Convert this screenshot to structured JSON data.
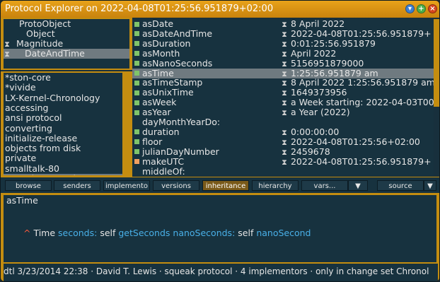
{
  "window": {
    "title": "Protocol Explorer on 2022-04-08T01:25:56.951879+02:00"
  },
  "class_tree": [
    {
      "label": "ProtoObject",
      "icon": ""
    },
    {
      "label": "Object",
      "icon": ""
    },
    {
      "label": "Magnitude",
      "icon": "hourglass-icon"
    },
    {
      "label": "DateAndTime",
      "icon": "hourglass-icon",
      "selected": true
    }
  ],
  "categories": [
    "*ston-core",
    "*vivide",
    "LX-Kernel-Chronology",
    "accessing",
    "ansi protocol",
    "converting",
    "initialize-release",
    "objects from disk",
    "private",
    "smalltalk-80",
    "squeak protocol"
  ],
  "selected_category": "squeak protocol",
  "messages": [
    {
      "name": "asDate",
      "value": "8 April 2022",
      "mark": "green"
    },
    {
      "name": "asDateAndTime",
      "value": "2022-04-08T01:25:56.951879+",
      "mark": "green"
    },
    {
      "name": "asDuration",
      "value": "0:01:25:56.951879",
      "mark": "green"
    },
    {
      "name": "asMonth",
      "value": "April 2022",
      "mark": "green"
    },
    {
      "name": "asNanoSeconds",
      "value": "5156951879000",
      "mark": "green"
    },
    {
      "name": "asTime",
      "value": "1:25:56.951879 am",
      "mark": "green",
      "selected": true
    },
    {
      "name": "asTimeStamp",
      "value": "8 April 2022 1:25:56.951879 am",
      "mark": "green"
    },
    {
      "name": "asUnixTime",
      "value": "1649373956",
      "mark": "green"
    },
    {
      "name": "asWeek",
      "value": "a Week starting: 2022-04-03T00",
      "mark": "green"
    },
    {
      "name": "asYear",
      "value": "a Year (2022)",
      "mark": "green"
    },
    {
      "name": "dayMonthYearDo:",
      "value": "",
      "mark": ""
    },
    {
      "name": "duration",
      "value": "0:00:00:00",
      "mark": "green"
    },
    {
      "name": "floor",
      "value": "2022-04-08T01:25:56+02:00",
      "mark": "green"
    },
    {
      "name": "julianDayNumber",
      "value": "2459678",
      "mark": "green"
    },
    {
      "name": "makeUTC",
      "value": "2022-04-08T01:25:56.951879+",
      "mark": "orange"
    },
    {
      "name": "middleOf:",
      "value": "",
      "mark": ""
    }
  ],
  "buttons": [
    "browse",
    "senders",
    "implemento",
    "versions",
    "inheritance",
    "hierarchy",
    "vars...",
    "▼",
    "source",
    "▼"
  ],
  "active_button": "inheritance",
  "code": {
    "selector": "asTime",
    "caret": "^",
    "tokens": [
      {
        "text": "Time ",
        "color": "plain"
      },
      {
        "text": "seconds:",
        "color": "blue"
      },
      {
        "text": " self ",
        "color": "plain"
      },
      {
        "text": "getSeconds",
        "color": "blue"
      },
      {
        "text": " ",
        "color": "plain"
      },
      {
        "text": "nanoSeconds:",
        "color": "blue"
      },
      {
        "text": " self ",
        "color": "plain"
      },
      {
        "text": "nanoSecond",
        "color": "blue"
      }
    ]
  },
  "status": "dtl 3/23/2014 22:38 · David T. Lewis · squeak protocol · 4 implementors · only in change set Chronol",
  "colors": {
    "accent": "#c48d10",
    "background": "#17323f",
    "selection": "#6f7a80",
    "keyword": "#49b0e8",
    "caret": "#ff5a3c",
    "mark_green": "#7fc46a",
    "mark_orange": "#f0a060"
  }
}
